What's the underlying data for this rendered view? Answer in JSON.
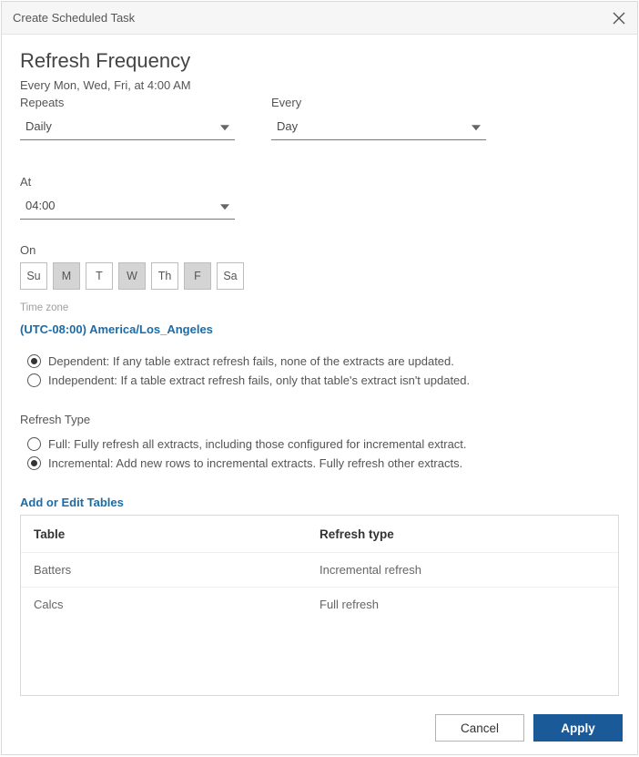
{
  "dialog": {
    "title": "Create Scheduled Task"
  },
  "heading": "Refresh Frequency",
  "summary": "Every Mon, Wed, Fri, at 4:00 AM",
  "repeats": {
    "label": "Repeats",
    "value": "Daily"
  },
  "every": {
    "label": "Every",
    "value": "Day"
  },
  "at": {
    "label": "At",
    "value": "04:00"
  },
  "on": {
    "label": "On",
    "days": [
      {
        "abbr": "Su",
        "selected": false
      },
      {
        "abbr": "M",
        "selected": true
      },
      {
        "abbr": "T",
        "selected": false
      },
      {
        "abbr": "W",
        "selected": true
      },
      {
        "abbr": "Th",
        "selected": false
      },
      {
        "abbr": "F",
        "selected": true
      },
      {
        "abbr": "Sa",
        "selected": false
      }
    ]
  },
  "timezone": {
    "label": "Time zone",
    "value": "(UTC-08:00) America/Los_Angeles"
  },
  "dependency": {
    "options": [
      {
        "label": "Dependent: If any table extract refresh fails, none of the extracts are updated.",
        "checked": true
      },
      {
        "label": "Independent: If a table extract refresh fails, only that table's extract isn't updated.",
        "checked": false
      }
    ]
  },
  "refreshType": {
    "label": "Refresh Type",
    "options": [
      {
        "label": "Full: Fully refresh all extracts, including those configured for incremental extract.",
        "checked": false
      },
      {
        "label": "Incremental: Add new rows to incremental extracts. Fully refresh other extracts.",
        "checked": true
      }
    ]
  },
  "addEditLink": "Add or Edit Tables",
  "table": {
    "headers": {
      "table": "Table",
      "refreshType": "Refresh type"
    },
    "rows": [
      {
        "table": "Batters",
        "refreshType": "Incremental refresh"
      },
      {
        "table": "Calcs",
        "refreshType": "Full refresh"
      }
    ]
  },
  "footer": {
    "cancel": "Cancel",
    "apply": "Apply"
  }
}
